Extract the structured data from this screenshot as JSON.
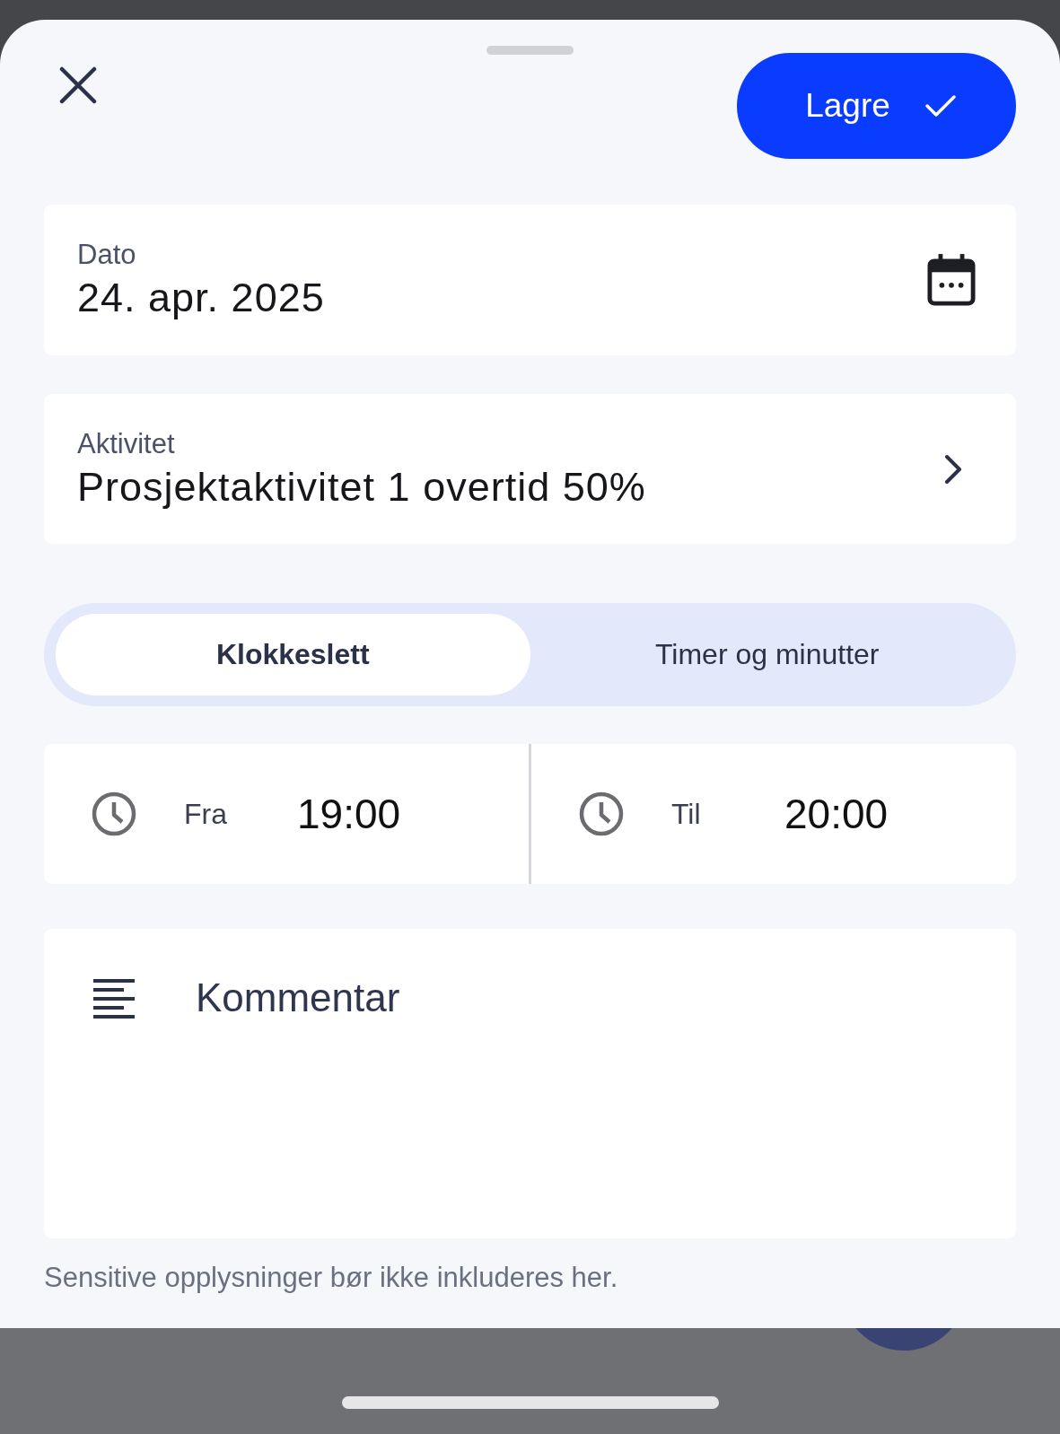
{
  "save_button": {
    "label": "Lagre"
  },
  "date_field": {
    "label": "Dato",
    "value": "24. apr. 2025"
  },
  "activity_field": {
    "label": "Aktivitet",
    "value": "Prosjektaktivitet 1 overtid 50%"
  },
  "mode_tabs": [
    {
      "label": "Klokkeslett",
      "selected": true
    },
    {
      "label": "Timer og minutter",
      "selected": false
    }
  ],
  "time_range": [
    {
      "label": "Fra",
      "value": "19:00"
    },
    {
      "label": "Til",
      "value": "20:00"
    }
  ],
  "comment": {
    "placeholder": "Kommentar"
  },
  "hint": "Sensitive opplysninger bør ikke inkluderes her."
}
